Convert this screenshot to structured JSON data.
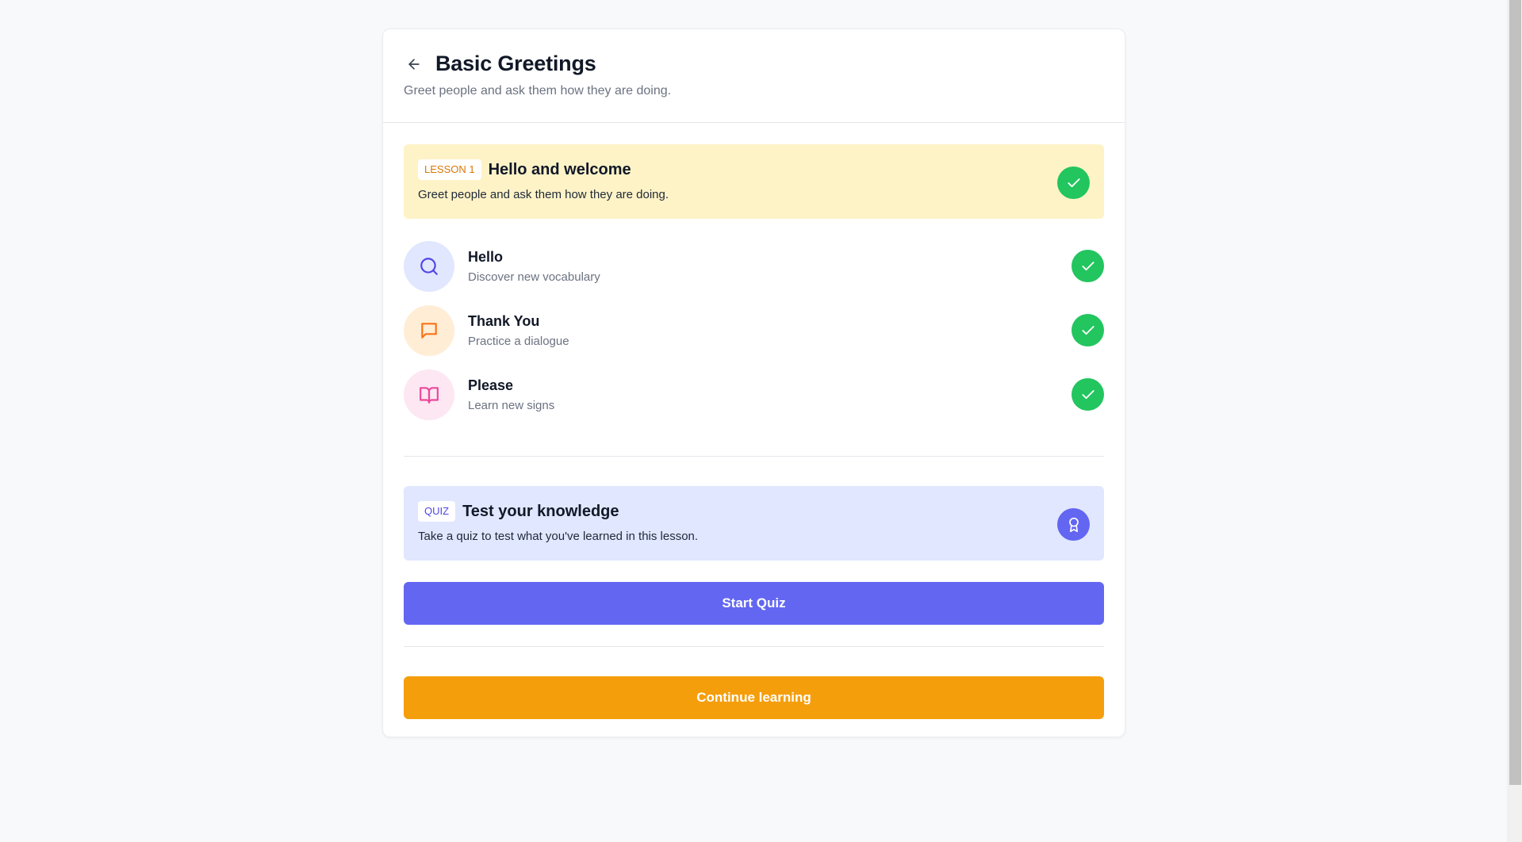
{
  "header": {
    "title": "Basic Greetings",
    "subtitle": "Greet people and ask them how they are doing."
  },
  "lesson": {
    "tag": "LESSON 1",
    "title": "Hello and welcome",
    "description": "Greet people and ask them how they are doing.",
    "completed": true
  },
  "activities": [
    {
      "title": "Hello",
      "subtitle": "Discover new vocabulary",
      "icon": "search-icon",
      "color": "#4f46e5",
      "bg": "#e0e7ff",
      "completed": true
    },
    {
      "title": "Thank You",
      "subtitle": "Practice a dialogue",
      "icon": "chat-bubble-icon",
      "color": "#f97316",
      "bg": "#ffedd5",
      "completed": true
    },
    {
      "title": "Please",
      "subtitle": "Learn new signs",
      "icon": "book-open-icon",
      "color": "#ec4899",
      "bg": "#fce7f3",
      "completed": true
    }
  ],
  "quiz": {
    "tag": "QUIZ",
    "title": "Test your knowledge",
    "description": "Take a quiz to test what you've learned in this lesson.",
    "icon": "award-icon"
  },
  "buttons": {
    "start_quiz": "Start Quiz",
    "continue": "Continue learning"
  },
  "colors": {
    "primary": "#6366f1",
    "success": "#22c55e",
    "accent": "#f59e0b",
    "lesson_bg": "#fef3c7",
    "quiz_bg": "#e0e7ff"
  }
}
